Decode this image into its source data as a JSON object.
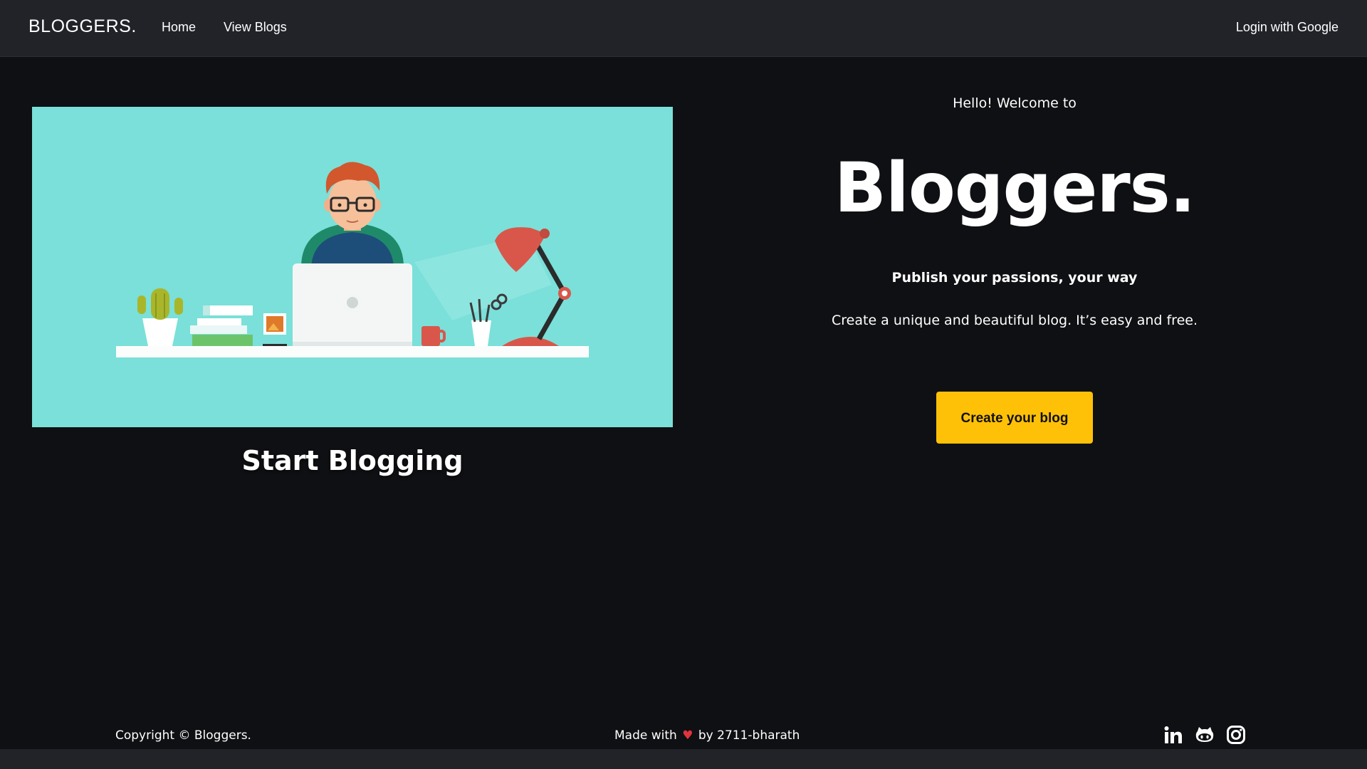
{
  "navbar": {
    "brand": "BLOGGERS.",
    "links": [
      {
        "label": "Home"
      },
      {
        "label": "View Blogs"
      }
    ],
    "login_label": "Login with Google"
  },
  "hero": {
    "caption": "Start Blogging",
    "welcome": "Hello! Welcome to",
    "title": "Bloggers.",
    "tagline": "Publish your passions, your way",
    "description": "Create a unique and beautiful blog. It’s easy and free.",
    "cta_label": "Create your blog"
  },
  "footer": {
    "copyright": "Copyright © Bloggers.",
    "made_with_prefix": "Made with",
    "heart": "♥",
    "made_with_suffix": "by 2711-bharath",
    "social_icons": [
      "linkedin-icon",
      "github-icon",
      "instagram-icon"
    ]
  },
  "colors": {
    "page_background": "#0f1013",
    "navbar_background": "#212329",
    "illustration_background": "#7ae0d9",
    "cta_background": "#ffc107",
    "heart": "#e0343d"
  }
}
